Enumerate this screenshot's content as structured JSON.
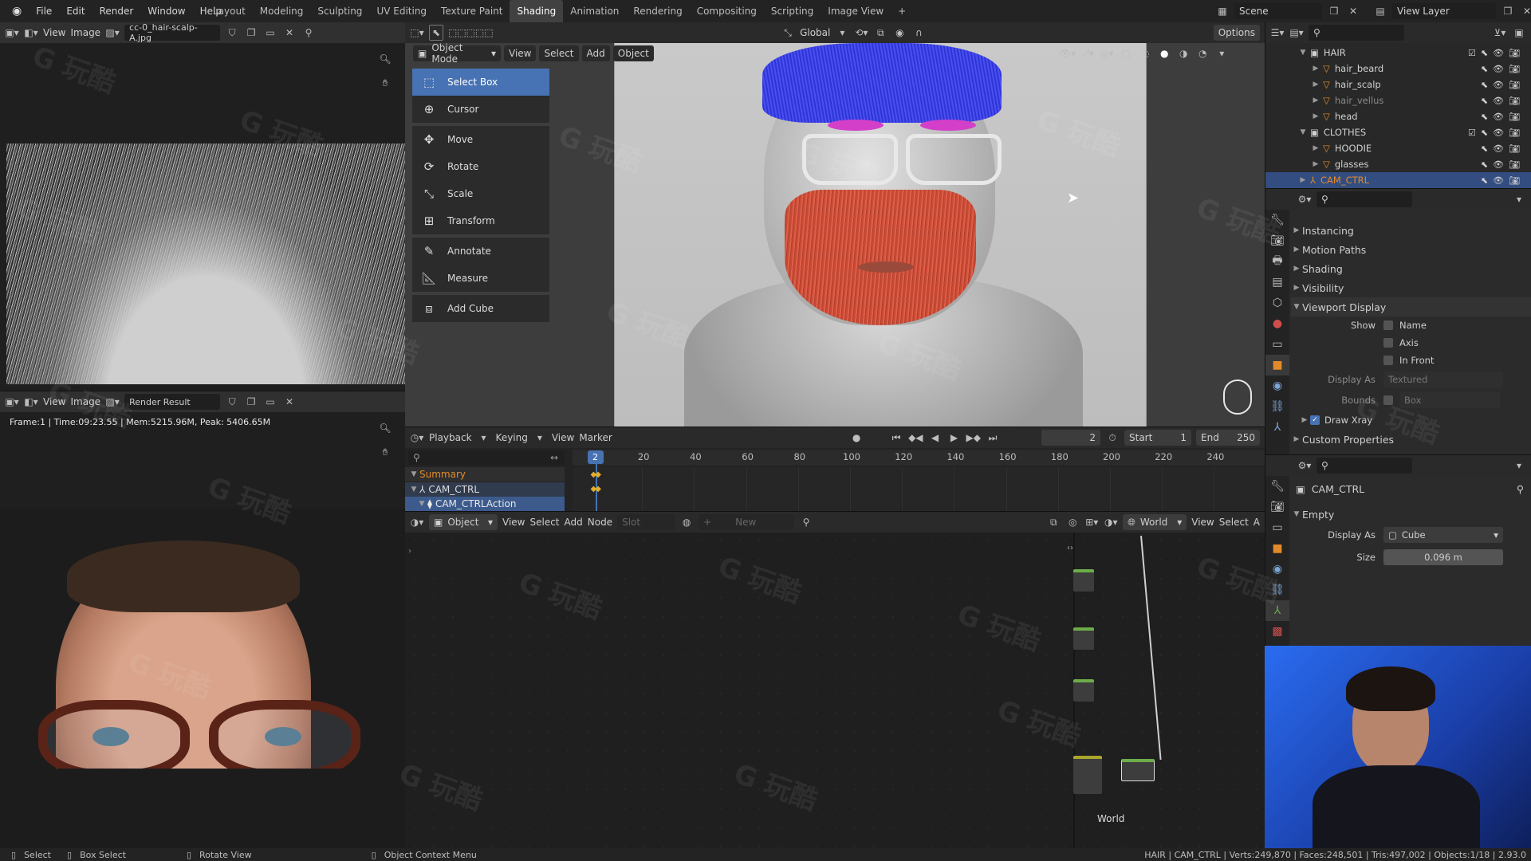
{
  "topbar": {
    "menus": [
      "File",
      "Edit",
      "Render",
      "Window",
      "Help"
    ],
    "workspaces": [
      "Layout",
      "Modeling",
      "Sculpting",
      "UV Editing",
      "Texture Paint",
      "Shading",
      "Animation",
      "Rendering",
      "Compositing",
      "Scripting",
      "Image View"
    ],
    "active_workspace": "Shading",
    "scene": "Scene",
    "view_layer": "View Layer"
  },
  "image_editor_top": {
    "menus": [
      "View",
      "Image"
    ],
    "image_name": "cc-0_hair-scalp-A.jpg"
  },
  "image_editor_bottom": {
    "menus": [
      "View",
      "Image"
    ],
    "image_name": "Render Result",
    "info": "Frame:1 | Time:09:23.55 | Mem:5215.96M, Peak: 5406.65M"
  },
  "viewport": {
    "mode": "Object Mode",
    "menus": [
      "View",
      "Select",
      "Add",
      "Object"
    ],
    "transform": "Global",
    "options": "Options",
    "tools": [
      "Select Box",
      "Cursor",
      "Move",
      "Rotate",
      "Scale",
      "Transform",
      "Annotate",
      "Measure",
      "Add Cube"
    ],
    "active_tool": "Select Box"
  },
  "timeline": {
    "menus": [
      "Playback",
      "Keying",
      "View",
      "Marker"
    ],
    "current_frame": "2",
    "start_label": "Start",
    "start": "1",
    "end_label": "End",
    "end": "250",
    "ticks": [
      "20",
      "40",
      "60",
      "80",
      "100",
      "120",
      "140",
      "160",
      "180",
      "200",
      "220",
      "240"
    ],
    "playhead_label": "2",
    "channels": [
      "Summary",
      "CAM_CTRL",
      "CAM_CTRLAction"
    ]
  },
  "node_editor": {
    "type": "Object",
    "menus": [
      "View",
      "Select",
      "Add",
      "Node"
    ],
    "slot": "Slot",
    "new_label": "New",
    "world_selector": "World",
    "right_menus": [
      "View",
      "Select",
      "A"
    ],
    "world_label": "World"
  },
  "outliner": {
    "items": [
      {
        "name": "HAIR",
        "indent": 0,
        "icon": "collection"
      },
      {
        "name": "hair_beard",
        "indent": 1,
        "icon": "object"
      },
      {
        "name": "hair_scalp",
        "indent": 1,
        "icon": "object"
      },
      {
        "name": "hair_vellus",
        "indent": 1,
        "icon": "object"
      },
      {
        "name": "head",
        "indent": 1,
        "icon": "object"
      },
      {
        "name": "CLOTHES",
        "indent": 0,
        "icon": "collection"
      },
      {
        "name": "HOODIE",
        "indent": 1,
        "icon": "object"
      },
      {
        "name": "glasses",
        "indent": 1,
        "icon": "object"
      },
      {
        "name": "CAM_CTRL",
        "indent": 0,
        "icon": "empty"
      }
    ],
    "selected": "CAM_CTRL"
  },
  "properties": {
    "sections": [
      "Instancing",
      "Motion Paths",
      "Shading",
      "Visibility",
      "Viewport Display"
    ],
    "show_label": "Show",
    "checks": [
      "Name",
      "Axis",
      "In Front"
    ],
    "display_as_label": "Display As",
    "display_as_value": "Textured",
    "bounds_label": "Bounds",
    "bounds_value": "Box",
    "draw_xray": "Draw Xray",
    "custom_properties": "Custom Properties"
  },
  "data_props": {
    "object_name": "CAM_CTRL",
    "section": "Empty",
    "display_as_label": "Display As",
    "display_as_value": "Cube",
    "size_label": "Size",
    "size_value": "0.096 m"
  },
  "statusbar": {
    "select": "Select",
    "box_select": "Box Select",
    "rotate_view": "Rotate View",
    "context_menu": "Object Context Menu",
    "stats": "HAIR | CAM_CTRL | Verts:249,870 | Faces:248,501 | Tris:497,002 | Objects:1/18 | 2.93.0"
  },
  "watermark": "G 玩酷",
  "colors": {
    "accent": "#4772b3",
    "orange": "#e38a28",
    "selected_row": "#334d80"
  }
}
